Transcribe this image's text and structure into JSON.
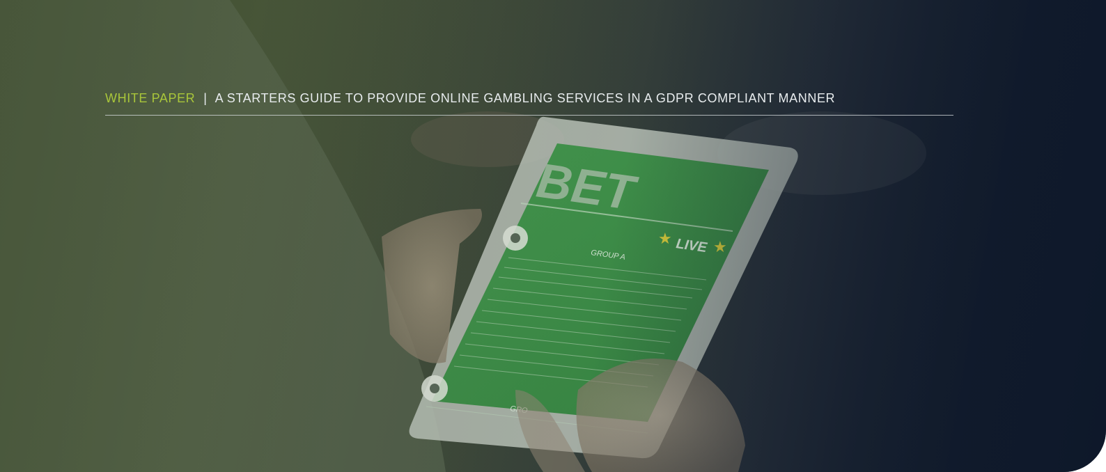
{
  "header": {
    "label": "WHITE PAPER",
    "separator": "|",
    "title": "A STARTERS GUIDE TO PROVIDE ONLINE GAMBLING SERVICES IN A GDPR COMPLIANT MANNER"
  },
  "tablet": {
    "brand": "BET",
    "live": "LIVE",
    "group_a": "GROUP A",
    "group_b": "GRO"
  },
  "colors": {
    "accent": "#a9c63a",
    "tablet_screen": "#2f8a3c",
    "navy": "#0f1a2c"
  },
  "icons": [
    "soccer-ball-icon",
    "star-icon"
  ]
}
